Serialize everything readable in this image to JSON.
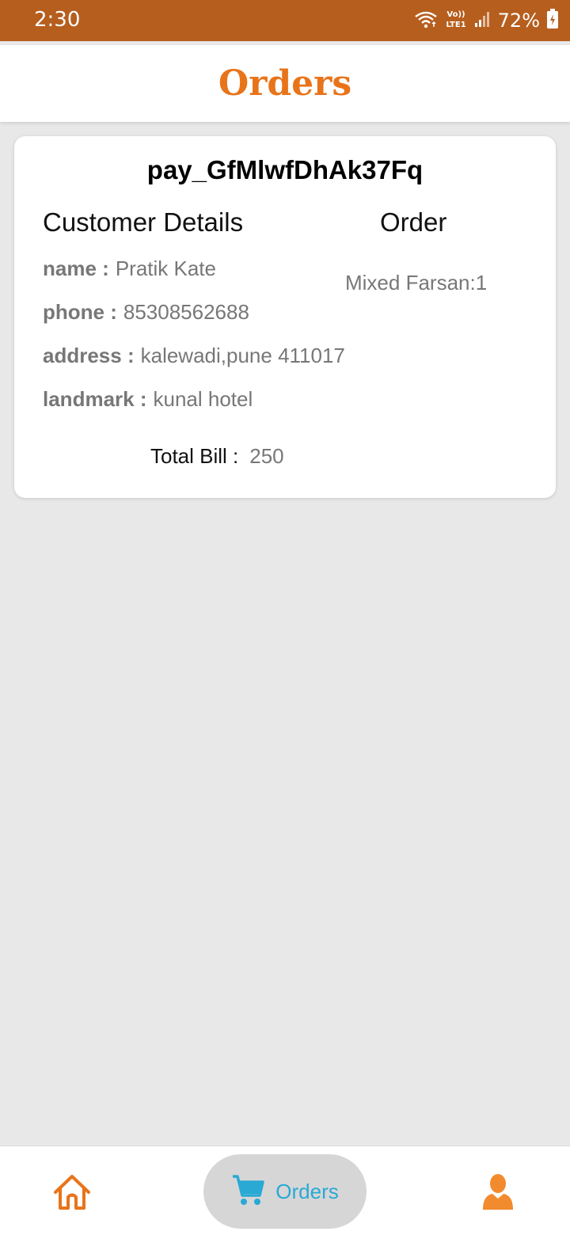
{
  "status_bar": {
    "time": "2:30",
    "battery": "72%",
    "icons": [
      "wifi-icon",
      "volte-icon",
      "signal-icon",
      "battery-charging-icon"
    ],
    "volte_text": "Vo)) LTE1"
  },
  "header": {
    "title": "Orders"
  },
  "order": {
    "payment_id": "pay_GfMlwfDhAk37Fq",
    "customer_heading": "Customer Details",
    "order_heading": "Order",
    "fields": {
      "name_label": "name :",
      "name_value": "Pratik Kate",
      "phone_label": "phone :",
      "phone_value": "85308562688",
      "address_label": "address :",
      "address_value": "kalewadi,pune 411017",
      "landmark_label": "landmark :",
      "landmark_value": "kunal hotel"
    },
    "items": [
      "Mixed Farsan:1"
    ],
    "total_label": "Total Bill :",
    "total_value": "250"
  },
  "bottom_nav": {
    "home_icon": "home-icon",
    "orders_label": "Orders",
    "orders_icon": "cart-icon",
    "profile_icon": "user-icon",
    "active": "orders"
  },
  "colors": {
    "status_bar": "#b65e1e",
    "accent": "#e8741a",
    "active_nav": "#29a9d4",
    "background": "#e8e8e8"
  }
}
